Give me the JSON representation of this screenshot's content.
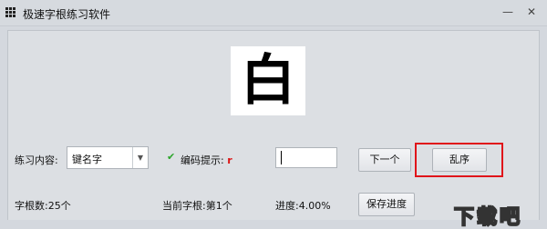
{
  "window": {
    "title": "极速字根练习软件",
    "minimize_glyph": "—",
    "close_glyph": "✕"
  },
  "display": {
    "current_char": "白"
  },
  "practice": {
    "content_label": "练习内容:",
    "content_value": "键名字",
    "hint_label": "编码提示:",
    "hint_code": "r",
    "answer_value": ""
  },
  "buttons": {
    "next": "下一个",
    "shuffle": "乱序",
    "save_progress": "保存进度"
  },
  "status": {
    "count": "字根数:25个",
    "current": "当前字根:第1个",
    "progress": "进度:4.00%",
    "progress_value": 0.04
  },
  "watermark": {
    "text": "下载吧"
  },
  "colors": {
    "highlight": "#e0141a",
    "hint_code": "#d11111",
    "check": "#2aa52a"
  }
}
